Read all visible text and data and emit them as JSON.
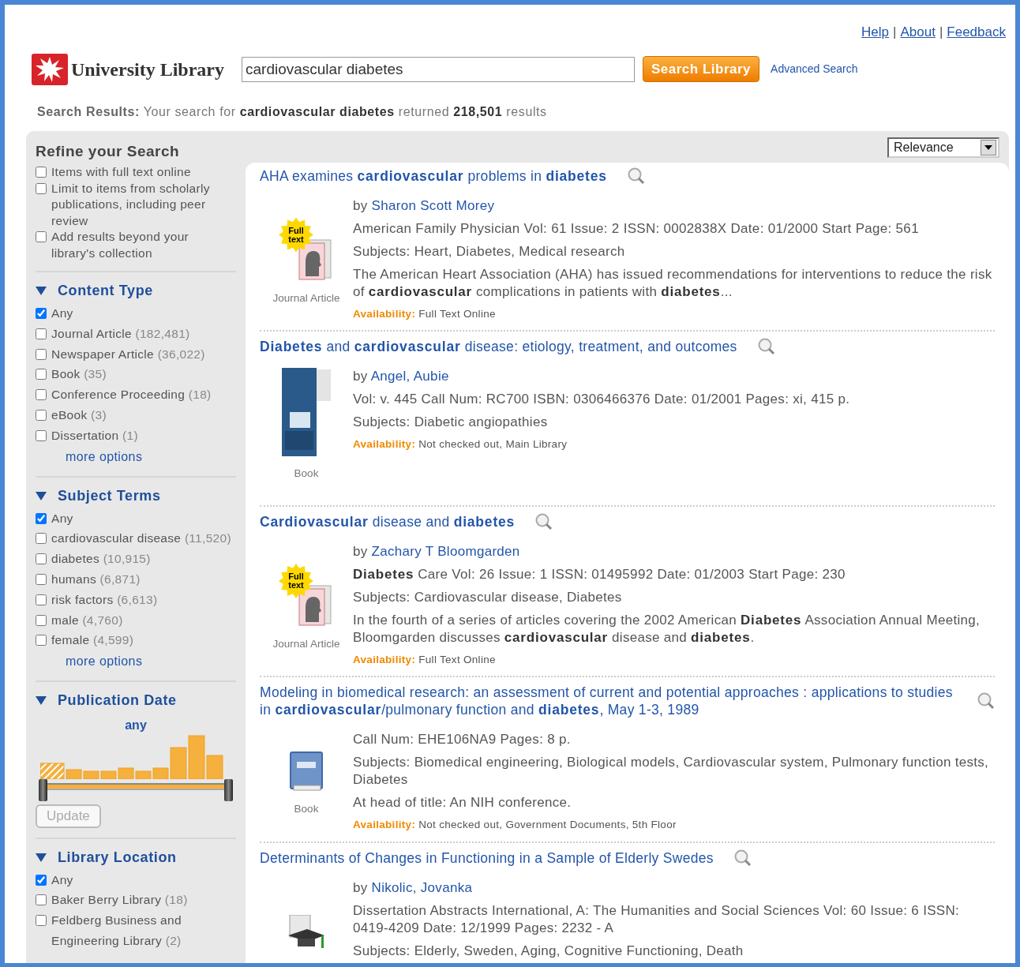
{
  "header": {
    "links": [
      {
        "kind": "link",
        "text": "Help"
      },
      {
        "kind": "separator",
        "text": "|"
      },
      {
        "kind": "link",
        "text": "About"
      },
      {
        "kind": "separator",
        "text": "|"
      },
      {
        "kind": "link",
        "text": "Feedback"
      }
    ],
    "logo": "University Library",
    "search": {
      "value": "cardiovascular diabetes"
    },
    "search_button": "Search Library",
    "advanced": "Advanced Search"
  },
  "summary": {
    "label": "Search Results:",
    "text": "Your search for **cardiovascular diabetes** returned **218,501** results"
  },
  "sidebar": {
    "title": "Refine your Search",
    "options": [
      {
        "label": "Items with full text online",
        "checked": false
      },
      {
        "label": "Limit to items from scholarly publications, including peer review",
        "checked": false
      },
      {
        "label": "Add results beyond your library's collection",
        "checked": false
      }
    ],
    "facets": [
      {
        "kind": "checklist",
        "title": "Content Type",
        "expanded": true,
        "items": [
          {
            "label": "Any",
            "checked": true
          },
          {
            "label": "Journal Article",
            "count": "(182,481)",
            "checked": false
          },
          {
            "label": "Newspaper Article",
            "count": "(36,022)",
            "checked": false
          },
          {
            "label": "Book",
            "count": "(35)",
            "checked": false
          },
          {
            "label": "Conference Proceeding",
            "count": "(18)",
            "checked": false
          },
          {
            "label": "eBook",
            "count": "(3)",
            "checked": false
          },
          {
            "label": "Dissertation",
            "count": "(1)",
            "checked": false
          }
        ],
        "more": "more options"
      },
      {
        "kind": "checklist",
        "title": "Subject Terms",
        "expanded": true,
        "items": [
          {
            "label": "Any",
            "checked": true
          },
          {
            "label": "cardiovascular disease",
            "count": "(11,520)",
            "checked": false
          },
          {
            "label": "diabetes",
            "count": "(10,915)",
            "checked": false
          },
          {
            "label": "humans",
            "count": "(6,871)",
            "checked": false
          },
          {
            "label": "risk factors",
            "count": "(6,613)",
            "checked": false
          },
          {
            "label": "male",
            "count": "(4,760)",
            "checked": false
          },
          {
            "label": "female",
            "count": "(4,599)",
            "checked": false
          }
        ],
        "more": "more options"
      },
      {
        "kind": "date",
        "title": "Publication Date",
        "expanded": true,
        "value": "any",
        "handles": [
          {
            "level": 0
          },
          {
            "level": 1
          }
        ],
        "button": "Update"
      },
      {
        "kind": "checklist",
        "title": "Library Location",
        "expanded": true,
        "items": [
          {
            "label": "Any",
            "checked": true
          },
          {
            "label": "Baker Berry Library",
            "count": "(18)",
            "checked": false
          },
          {
            "label": "Feldberg Business and Engineering Library",
            "count": "(2)",
            "checked": false
          }
        ]
      }
    ]
  },
  "sort": "Relevance",
  "results": [
    {
      "title": "AHA examines **cardiovascular** problems in **diabetes**",
      "author": "Sharon Scott Morey",
      "by": "by",
      "kind": "journal",
      "badge": "Full text",
      "type": "Journal Article",
      "lines": [
        "American Family Physician Vol: 61 Issue: 2 ISSN: 0002838X Date: 01/2000 Start Page: 561",
        "Subjects: Heart, Diabetes, Medical research",
        "The American Heart Association (AHA) has issued recommendations for interventions to reduce the risk of **cardiovascular** complications in patients with **diabetes**..."
      ],
      "availability_label": "Availability:",
      "availability": "Full Text Online"
    },
    {
      "title": "**Diabetes** and **cardiovascular** disease: etiology, treatment, and outcomes",
      "author": "Angel, Aubie",
      "by": "by",
      "kind": "cover",
      "type": "Book",
      "lines": [
        "Vol: v. 445 Call Num: RC700 ISBN: 0306466376 Date: 01/2001 Pages: xi, 415 p.",
        "Subjects: Diabetic angiopathies"
      ],
      "availability_label": "Availability:",
      "availability": "Not checked out, Main Library"
    },
    {
      "title": "**Cardiovascular** disease and **diabetes**",
      "author": "Zachary T Bloomgarden",
      "by": "by",
      "kind": "journal",
      "badge": "Full text",
      "type": "Journal Article",
      "lines": [
        "**Diabetes** Care Vol: 26 Issue: 1 ISSN: 01495992 Date: 01/2003 Start Page: 230",
        "Subjects: Cardiovascular disease, Diabetes",
        "In the fourth of a series of articles covering the 2002 American **Diabetes** Association Annual Meeting, Bloomgarden discusses **cardiovascular** disease and **diabetes**."
      ],
      "availability_label": "Availability:",
      "availability": "Full Text Online"
    },
    {
      "title": "Modeling in biomedical research: an assessment of current and potential approaches : applications to studies in **cardiovascular**/pulmonary function and **diabetes**, May 1-3, 1989",
      "kind": "book",
      "type": "Book",
      "lines": [
        "Call Num: EHE106NA9 Pages: 8 p.",
        "Subjects: Biomedical engineering, Biological models, Cardiovascular system, Pulmonary function tests, Diabetes",
        "At head of title: An NIH conference."
      ],
      "availability_label": "Availability:",
      "availability": "Not checked out, Government Documents, 5th Floor"
    },
    {
      "title": "Determinants of Changes in Functioning in a Sample of Elderly Swedes",
      "author": "Nikolic, Jovanka",
      "by": "by",
      "kind": "dissertation",
      "lines": [
        "Dissertation Abstracts International, A: The Humanities and Social Sciences Vol: 60 Issue: 6 ISSN: 0419-4209 Date: 12/1999 Pages: 2232 - A",
        "Subjects: Elderly, Sweden, Aging, Cognitive Functioning, Death"
      ]
    }
  ]
}
